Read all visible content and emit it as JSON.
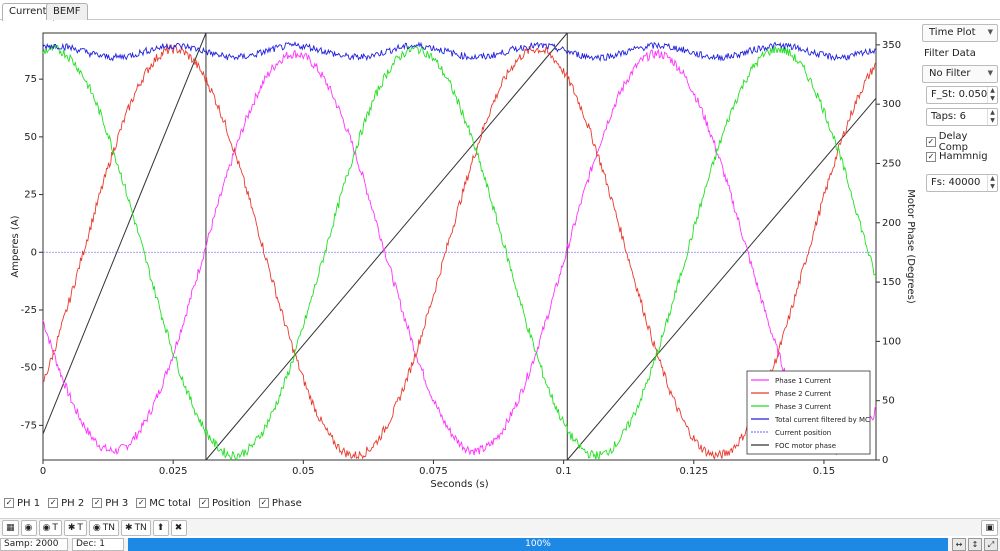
{
  "tabs": [
    {
      "label": "Current",
      "active": true
    },
    {
      "label": "BEMF",
      "active": false
    }
  ],
  "chart_data": {
    "type": "line",
    "xlabel": "Seconds (s)",
    "ylabel": "Amperes (A)",
    "y2label": "Motor Phase (Degrees)",
    "xlim": [
      0,
      0.16
    ],
    "ylim": [
      -90,
      95
    ],
    "y2lim": [
      0,
      360
    ],
    "xticks": [
      "0",
      "0.025",
      "0.05",
      "0.075",
      "0.1",
      "0.125",
      "0.15"
    ],
    "xtick_values": [
      0,
      0.025,
      0.05,
      0.075,
      0.1,
      0.125,
      0.15
    ],
    "yticks": [
      "-75",
      "-50",
      "-25",
      "0",
      "25",
      "50",
      "75"
    ],
    "ytick_values": [
      -75,
      -50,
      -25,
      0,
      25,
      50,
      75
    ],
    "y2ticks": [
      "0",
      "50",
      "100",
      "150",
      "200",
      "250",
      "300",
      "350"
    ],
    "y2tick_values": [
      0,
      50,
      100,
      150,
      200,
      250,
      300,
      350
    ],
    "grid": false,
    "legend_position": "bottom-right",
    "series": [
      {
        "name": "Phase 1 Current",
        "color": "#ff33ff",
        "amplitude": 86,
        "period": 0.0696,
        "phase_deg": 200,
        "axis": "left"
      },
      {
        "name": "Phase 2 Current",
        "color": "#e83a2e",
        "amplitude": 88,
        "period": 0.0696,
        "phase_deg": 320,
        "axis": "left"
      },
      {
        "name": "Phase 3 Current",
        "color": "#22e022",
        "amplitude": 88,
        "period": 0.0696,
        "phase_deg": 80,
        "axis": "left"
      },
      {
        "name": "Total current filtered by MC",
        "color": "#2222dd",
        "mean": 87,
        "axis": "left"
      },
      {
        "name": "Current position",
        "color": "#8080ff",
        "value": 0,
        "axis": "left"
      },
      {
        "name": "FOC motor phase",
        "color": "#333333",
        "axis": "right",
        "segments": [
          {
            "x": [
              0.0,
              0.0313
            ],
            "y": [
              22,
              360
            ]
          },
          {
            "x": [
              0.0313,
              0.1007
            ],
            "y": [
              0,
              360
            ]
          },
          {
            "x": [
              0.1007,
              0.16
            ],
            "y": [
              0,
              305
            ]
          }
        ]
      }
    ]
  },
  "panel": {
    "plot_mode": "Time Plot",
    "filter_data_label": "Filter Data",
    "filter_type": "No Filter",
    "f_st": "F_St: 0.050",
    "taps": "Taps: 6",
    "delay_comp": "Delay Comp",
    "delay_comp_checked": true,
    "hamming": "Hammnig",
    "hamming_checked": true,
    "fs": "Fs: 40000"
  },
  "channels": [
    {
      "label": "PH 1",
      "checked": true
    },
    {
      "label": "PH 2",
      "checked": true
    },
    {
      "label": "PH 3",
      "checked": true
    },
    {
      "label": "MC total",
      "checked": true
    },
    {
      "label": "Position",
      "checked": true
    },
    {
      "label": "Phase",
      "checked": true
    }
  ],
  "toolbar": [
    {
      "icon": "grid-icon",
      "glyph": "▦",
      "label": ""
    },
    {
      "icon": "record-icon",
      "glyph": "◉",
      "label": ""
    },
    {
      "icon": "record-target-icon",
      "glyph": "◉",
      "label": "T"
    },
    {
      "icon": "trigger-icon",
      "glyph": "✱",
      "label": "T"
    },
    {
      "icon": "record-target-icon",
      "glyph": "◉",
      "label": "TN"
    },
    {
      "icon": "trigger-icon",
      "glyph": "✱",
      "label": "TN"
    },
    {
      "icon": "upload-icon",
      "glyph": "⬆",
      "label": ""
    },
    {
      "icon": "stop-icon",
      "glyph": "✖",
      "label": ""
    }
  ],
  "status": {
    "samples": "Samp: 2000",
    "decimation": "Dec: 1",
    "progress": "100%",
    "progress_value": 1.0
  }
}
